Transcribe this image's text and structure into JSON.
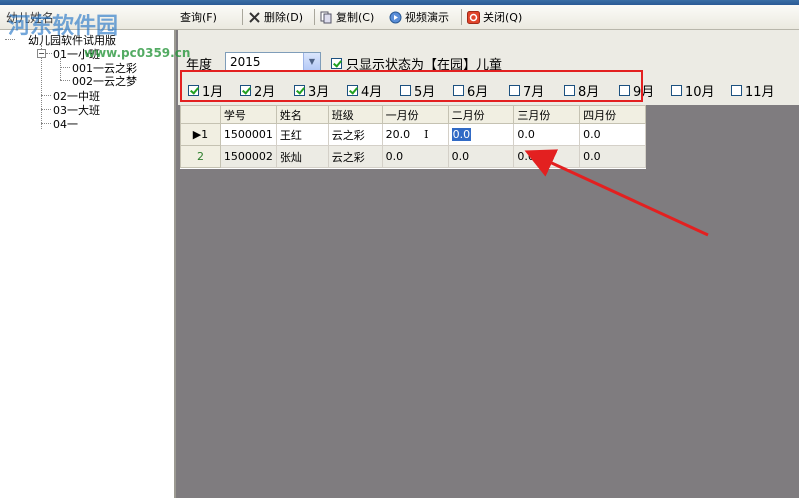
{
  "toolbar": {
    "tree_header": "幼儿姓名",
    "query_label": "查询(F)",
    "delete_label": "删除(D)",
    "copy_label": "复制(C)",
    "video_label": "视频演示",
    "close_label": "关闭(Q)"
  },
  "tree": {
    "root": "幼儿园软件试用版",
    "nodes": [
      "01一小班",
      "001一云之彩",
      "002一云之梦",
      "02一中班",
      "03一大班",
      "04一"
    ]
  },
  "filters": {
    "year_label": "年度",
    "year_value": "2015",
    "status_label": "只显示状态为【在园】儿童",
    "status_checked": true,
    "months": [
      {
        "label": "1月",
        "checked": true
      },
      {
        "label": "2月",
        "checked": true
      },
      {
        "label": "3月",
        "checked": true
      },
      {
        "label": "4月",
        "checked": true
      },
      {
        "label": "5月",
        "checked": false
      },
      {
        "label": "6月",
        "checked": false
      },
      {
        "label": "7月",
        "checked": false
      },
      {
        "label": "8月",
        "checked": false
      },
      {
        "label": "9月",
        "checked": false
      },
      {
        "label": "10月",
        "checked": false
      },
      {
        "label": "11月",
        "checked": false
      }
    ]
  },
  "grid": {
    "columns": [
      "学号",
      "姓名",
      "班级",
      "一月份",
      "二月份",
      "三月份",
      "四月份"
    ],
    "rows": [
      {
        "marker": "▶1",
        "cells": [
          "1500001",
          "王红",
          "云之彩",
          "20.0",
          "0.0",
          "0.0",
          "0.0"
        ]
      },
      {
        "marker": "2",
        "cells": [
          "1500002",
          "张灿",
          "云之彩",
          "0.0",
          "0.0",
          "0.0",
          "0.0"
        ]
      }
    ]
  },
  "watermark": {
    "text": "河东软件园",
    "url": "www.pc0359.cn"
  },
  "colors": {
    "highlight": "#e32020",
    "selection": "#316ac5",
    "background": "#7f7c7f"
  }
}
